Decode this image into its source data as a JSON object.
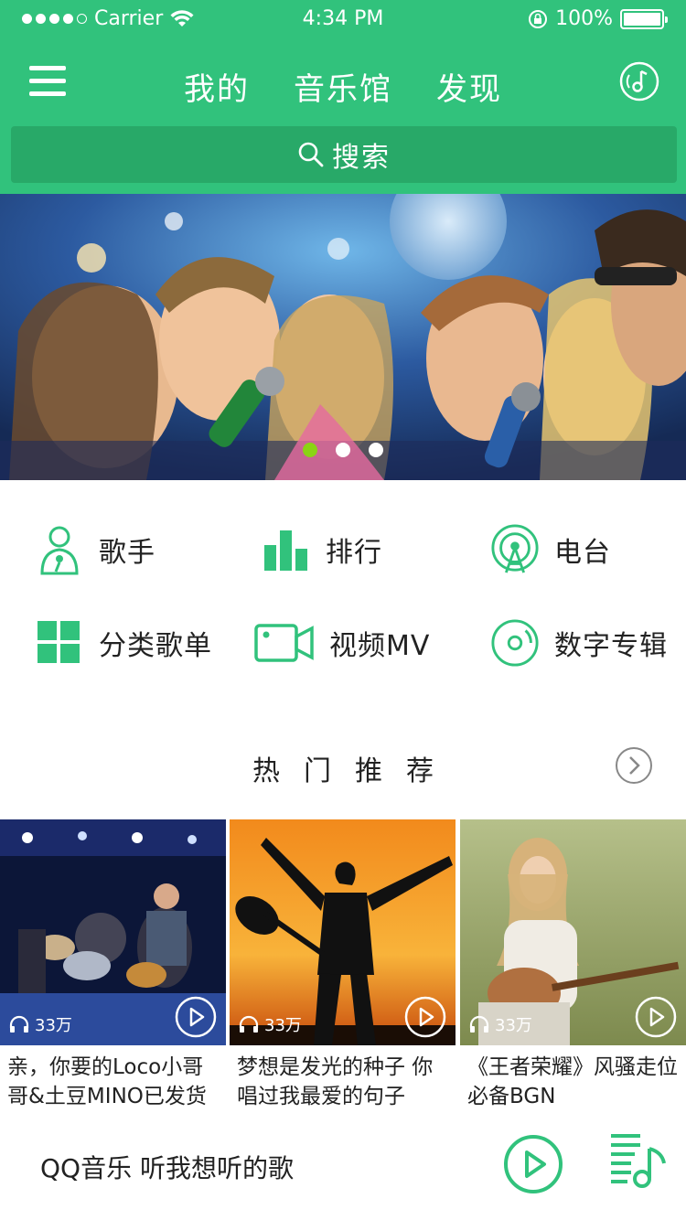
{
  "status_bar": {
    "carrier": "Carrier",
    "time": "4:34 PM",
    "battery": "100%"
  },
  "header": {
    "tabs": [
      {
        "label": "我的"
      },
      {
        "label": "音乐馆"
      },
      {
        "label": "发现"
      }
    ],
    "search_label": "搜索"
  },
  "banner": {
    "active_index": 0,
    "dots": 3
  },
  "categories": [
    {
      "label": "歌手",
      "icon": "singer-icon"
    },
    {
      "label": "排行",
      "icon": "chart-icon"
    },
    {
      "label": "电台",
      "icon": "radio-icon"
    },
    {
      "label": "分类歌单",
      "icon": "grid-icon"
    },
    {
      "label": "视频MV",
      "icon": "video-icon"
    },
    {
      "label": "数字专辑",
      "icon": "disc-icon"
    }
  ],
  "hot": {
    "title": "热门推荐",
    "items": [
      {
        "count": "33万",
        "title": "亲，你要的Loco小哥哥&土豆MINO已发货"
      },
      {
        "count": "33万",
        "title": "梦想是发光的种子 你唱过我最爱的句子"
      },
      {
        "count": "33万",
        "title": "《王者荣耀》风骚走位必备BGN"
      }
    ]
  },
  "player": {
    "now_playing": "QQ音乐 听我想听的歌"
  },
  "colors": {
    "brand": "#31c27c",
    "search_bg": "#28a968",
    "active_dot": "#8ad414"
  }
}
